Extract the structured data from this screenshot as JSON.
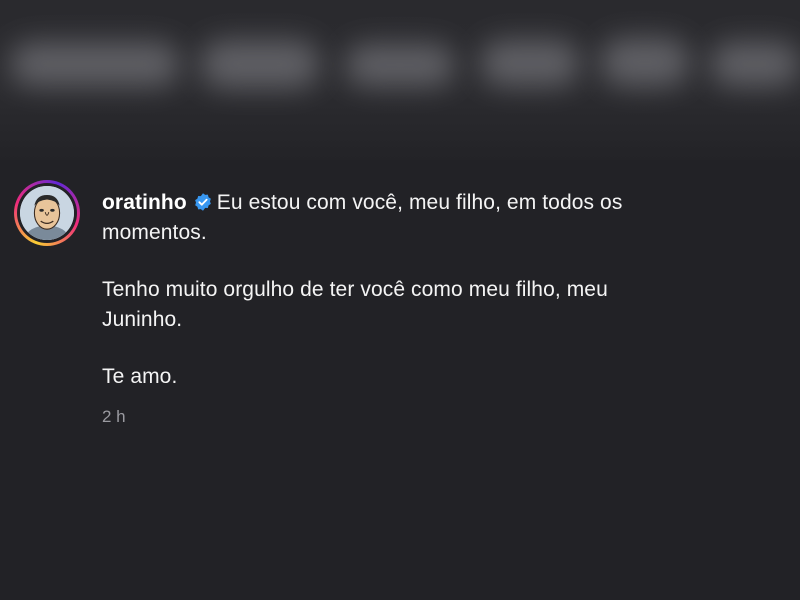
{
  "comment": {
    "username": "oratinho",
    "verified": true,
    "text_line1": "Eu estou com você, meu filho, em todos os",
    "text_line2": "momentos.",
    "text_line3": "Tenho muito orgulho de ter você como meu filho, meu",
    "text_line4": "Juninho.",
    "text_line5": "Te amo.",
    "timestamp": "2 h"
  },
  "colors": {
    "background": "#222226",
    "verified_badge": "#3897f0",
    "timestamp": "#9a9aa0",
    "avatar_ring_start": "#f9ce34",
    "avatar_ring_mid": "#ee2a7b",
    "avatar_ring_end": "#6228d7"
  },
  "icons": {
    "verified": "verified-badge-icon",
    "avatar": "cartoon-portrait"
  }
}
